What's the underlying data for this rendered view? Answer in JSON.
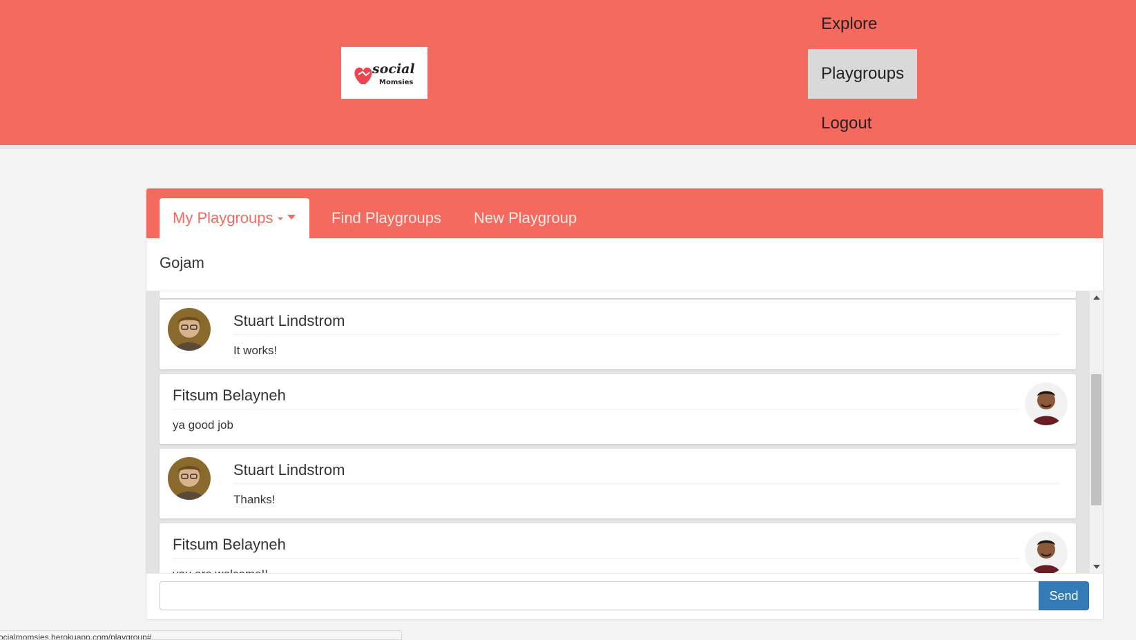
{
  "app": {
    "logo_text": "social Momsies"
  },
  "nav": {
    "items": [
      {
        "label": "Explore"
      },
      {
        "label": "Playgroups",
        "active": true
      },
      {
        "label": "Logout"
      }
    ]
  },
  "tabs": {
    "my_playgroups": "My Playgroups",
    "find_playgroups": "Find Playgroups",
    "new_playgroup": "New Playgroup"
  },
  "group": {
    "title": "Gojam"
  },
  "messages": [
    {
      "name": "Stuart Lindstrom",
      "text": "It works!",
      "align": "left"
    },
    {
      "name": "Fitsum Belayneh",
      "text": "ya good job",
      "align": "right"
    },
    {
      "name": "Stuart Lindstrom",
      "text": "Thanks!",
      "align": "left"
    },
    {
      "name": "Fitsum Belayneh",
      "text": "you are welcome!!",
      "align": "right"
    }
  ],
  "composer": {
    "value": "",
    "send_label": "Send"
  },
  "status_bar": {
    "url": "socialmomsies.herokuapp.com/playgroup#"
  },
  "colors": {
    "brand": "#f56a5e",
    "active_nav_bg": "#d9d9d9",
    "send_button": "#337ab7"
  }
}
